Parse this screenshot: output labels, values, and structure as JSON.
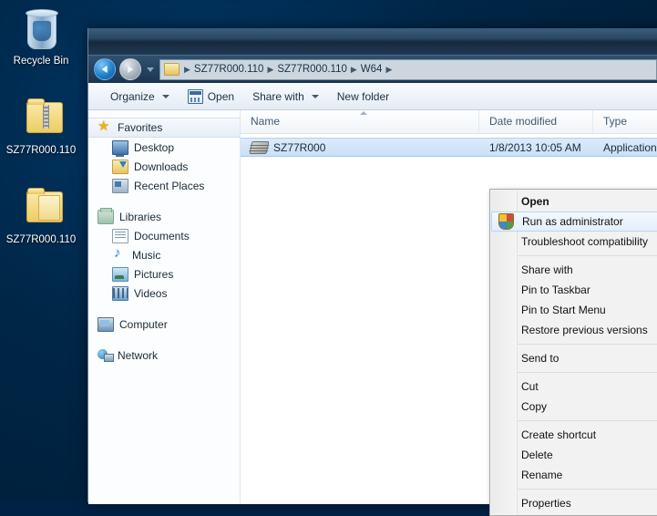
{
  "desktop": {
    "icons": [
      {
        "name": "Recycle Bin",
        "icon": "recycle-bin-icon"
      },
      {
        "name": "SZ77R000.110",
        "icon": "zipped-folder-icon"
      },
      {
        "name": "SZ77R000.110",
        "icon": "folder-icon"
      }
    ]
  },
  "window": {
    "nav": {
      "back": "Back",
      "forward": "Forward",
      "recent_pages": "Recent pages"
    },
    "breadcrumb": [
      "SZ77R000.110",
      "SZ77R000.110",
      "W64"
    ],
    "toolbar": {
      "organize": "Organize",
      "open": "Open",
      "share_with": "Share with",
      "new_folder": "New folder"
    },
    "sidebar": {
      "groups": [
        {
          "header": {
            "label": "Favorites",
            "icon": "star-icon"
          },
          "items": [
            {
              "label": "Desktop",
              "icon": "desktop-icon"
            },
            {
              "label": "Downloads",
              "icon": "downloads-icon"
            },
            {
              "label": "Recent Places",
              "icon": "recent-places-icon"
            }
          ]
        },
        {
          "header": {
            "label": "Libraries",
            "icon": "library-icon"
          },
          "items": [
            {
              "label": "Documents",
              "icon": "documents-icon"
            },
            {
              "label": "Music",
              "icon": "music-icon"
            },
            {
              "label": "Pictures",
              "icon": "pictures-icon"
            },
            {
              "label": "Videos",
              "icon": "videos-icon"
            }
          ]
        },
        {
          "header": {
            "label": "Computer",
            "icon": "computer-icon"
          },
          "items": []
        },
        {
          "header": {
            "label": "Network",
            "icon": "network-icon"
          },
          "items": []
        }
      ]
    },
    "columns": [
      {
        "label": "Name",
        "sorted": "ascending"
      },
      {
        "label": "Date modified",
        "sorted": ""
      },
      {
        "label": "Type",
        "sorted": ""
      }
    ],
    "files": [
      {
        "name": "SZ77R000",
        "date_modified": "1/8/2013 10:05 AM",
        "type": "Application",
        "icon": "application-chip-icon",
        "selected": true
      }
    ]
  },
  "context_menu": {
    "items": [
      {
        "label": "Open",
        "bold": true,
        "icon": "",
        "submenu": false,
        "highlighted": false
      },
      {
        "label": "Run as administrator",
        "bold": false,
        "icon": "uac-shield-icon",
        "submenu": false,
        "highlighted": true
      },
      {
        "label": "Troubleshoot compatibility",
        "bold": false,
        "icon": "",
        "submenu": false,
        "highlighted": false
      },
      {
        "separator": true
      },
      {
        "label": "Share with",
        "bold": false,
        "icon": "",
        "submenu": true,
        "highlighted": false
      },
      {
        "label": "Pin to Taskbar",
        "bold": false,
        "icon": "",
        "submenu": false,
        "highlighted": false
      },
      {
        "label": "Pin to Start Menu",
        "bold": false,
        "icon": "",
        "submenu": false,
        "highlighted": false
      },
      {
        "label": "Restore previous versions",
        "bold": false,
        "icon": "",
        "submenu": false,
        "highlighted": false
      },
      {
        "separator": true
      },
      {
        "label": "Send to",
        "bold": false,
        "icon": "",
        "submenu": true,
        "highlighted": false
      },
      {
        "separator": true
      },
      {
        "label": "Cut",
        "bold": false,
        "icon": "",
        "submenu": false,
        "highlighted": false
      },
      {
        "label": "Copy",
        "bold": false,
        "icon": "",
        "submenu": false,
        "highlighted": false
      },
      {
        "separator": true
      },
      {
        "label": "Create shortcut",
        "bold": false,
        "icon": "",
        "submenu": false,
        "highlighted": false
      },
      {
        "label": "Delete",
        "bold": false,
        "icon": "",
        "submenu": false,
        "highlighted": false
      },
      {
        "label": "Rename",
        "bold": false,
        "icon": "",
        "submenu": false,
        "highlighted": false
      },
      {
        "separator": true
      },
      {
        "label": "Properties",
        "bold": false,
        "icon": "",
        "submenu": false,
        "highlighted": false
      }
    ]
  },
  "colors": {
    "desktop_bg": "#002a4e",
    "selection": "#c9e0f7",
    "accent": "#2f7fc4"
  }
}
